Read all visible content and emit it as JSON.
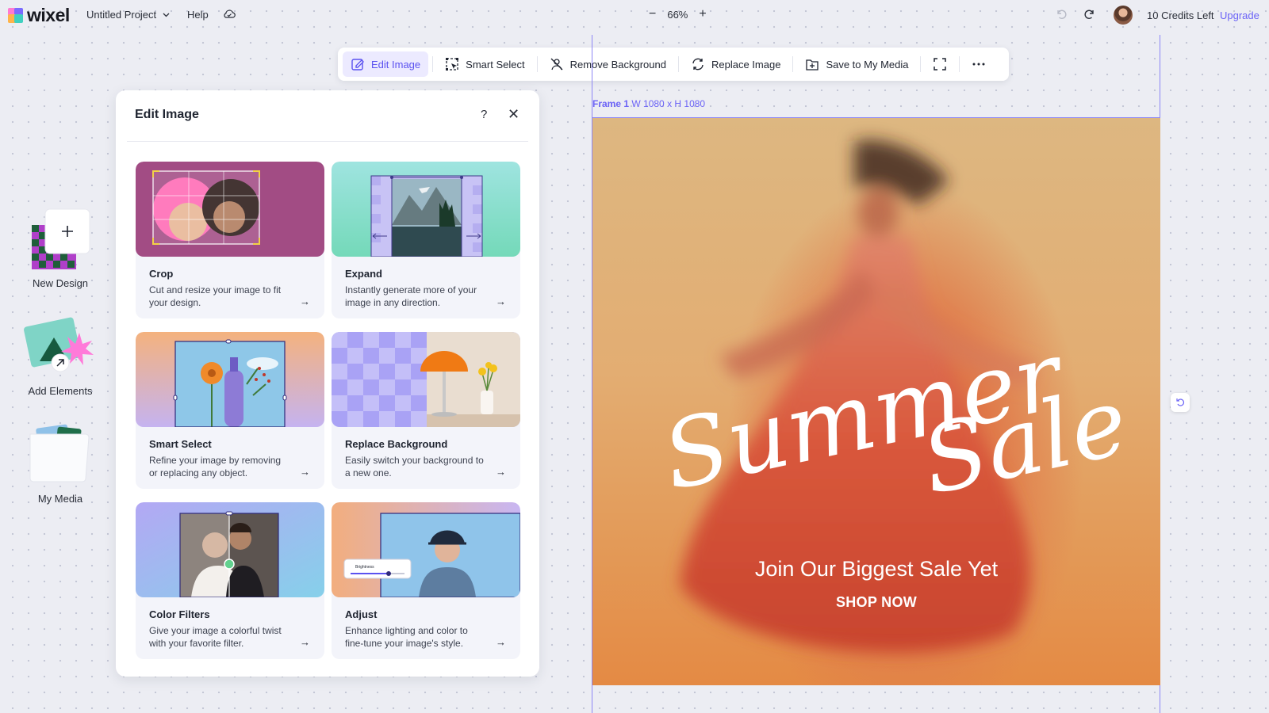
{
  "app": {
    "brand": "wixel",
    "project_name": "Untitled Project",
    "help_label": "Help"
  },
  "zoom": {
    "minus": "−",
    "value": "66%",
    "plus": "+"
  },
  "account": {
    "credits": "10 Credits Left",
    "upgrade": "Upgrade"
  },
  "colors": {
    "accent": "#6b63f6",
    "canvas_bg": "#ecedf3"
  },
  "rail": {
    "new_design": "New Design",
    "add_elements": "Add Elements",
    "my_media": "My Media"
  },
  "toolbar": {
    "edit_image": "Edit Image",
    "smart_select": "Smart Select",
    "remove_background": "Remove Background",
    "replace_image": "Replace Image",
    "save_to_media": "Save to My Media"
  },
  "panel": {
    "title": "Edit Image",
    "help": "?",
    "close": "✕",
    "cards": [
      {
        "title": "Crop",
        "desc": "Cut and resize your image to fit your design."
      },
      {
        "title": "Expand",
        "desc": "Instantly generate more of your image in any direction."
      },
      {
        "title": "Smart Select",
        "desc": "Refine your image by removing or replacing any object."
      },
      {
        "title": "Replace Background",
        "desc": "Easily switch your background to a new one."
      },
      {
        "title": "Color Filters",
        "desc": "Give your image a colorful twist with your favorite filter."
      },
      {
        "title": "Adjust",
        "desc": "Enhance lighting and color to fine-tune your image's style."
      }
    ],
    "arrow": "→",
    "adjust_slider_label": "Brightness"
  },
  "frame": {
    "name": "Frame 1",
    "size": "W 1080 x H 1080",
    "headline_1": "Summer",
    "headline_2": "Sale",
    "subtitle": "Join Our Biggest Sale Yet",
    "cta": "SHOP NOW"
  }
}
